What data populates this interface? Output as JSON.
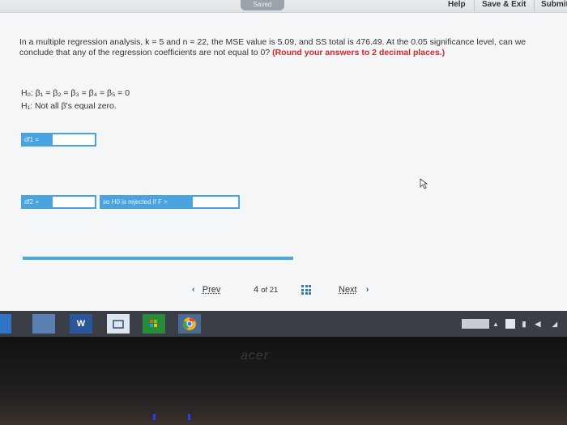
{
  "topbar": {
    "saved_label": "Saved",
    "help": "Help",
    "save_exit": "Save & Exit",
    "submit": "Submit"
  },
  "question": {
    "text_part1": "In a multiple regression analysis, k = 5 and n = 22, the MSE value is 5.09, and SS total is 476.49. At the 0.05 significance level, can we conclude that any of the regression coefficients are not equal to 0? ",
    "text_emphasis": "(Round your answers to 2 decimal places.)"
  },
  "hypotheses": {
    "h0": "H₀: β₁ = β₂ = β₃ = β₄ = β₅ = 0",
    "h1": "H₁: Not all β's equal zero."
  },
  "form": {
    "df1_label": "df1 =",
    "df1_value": "",
    "df2_label": "df2 =",
    "df2_value": "",
    "reject_label": "so H0 is rejected if F >",
    "reject_value": ""
  },
  "navigation": {
    "prev": "Prev",
    "page_current": "4",
    "page_of": "of 21",
    "next": "Next"
  },
  "taskbar": {
    "word_icon": "W",
    "bezel_brand": "acer"
  },
  "colors": {
    "accent_blue": "#4aa3e0",
    "emphasis_red": "#d0242c"
  }
}
